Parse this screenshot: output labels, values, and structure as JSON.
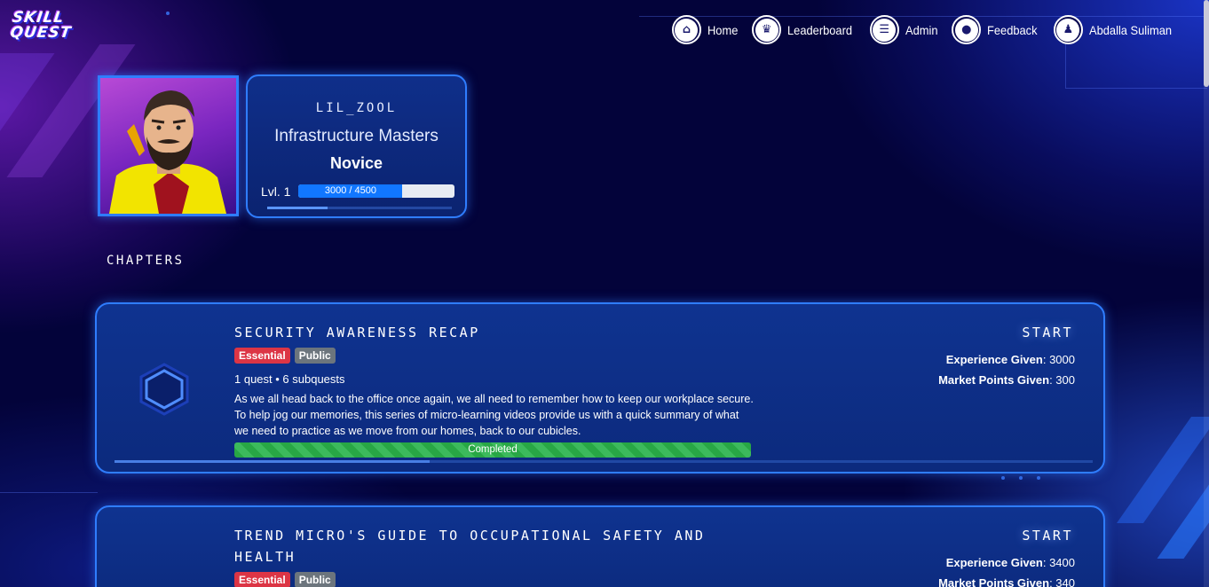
{
  "brand": {
    "line1": "SKILL",
    "line2": "QUEST"
  },
  "nav": [
    {
      "label": "Home",
      "icon": "home-icon",
      "glyph": "⌂"
    },
    {
      "label": "Leaderboard",
      "icon": "trophy-icon",
      "glyph": "♛"
    },
    {
      "label": "Admin",
      "icon": "list-icon",
      "glyph": "☰"
    },
    {
      "label": "Feedback",
      "icon": "chat-bubble-icon",
      "glyph": "●"
    },
    {
      "label": "Abdalla Suliman",
      "icon": "user-icon",
      "glyph": "♟"
    }
  ],
  "profile": {
    "username": "lil_zool",
    "team": "Infrastructure Masters",
    "rank": "Novice",
    "level": "Lvl. 1",
    "xp_text": "3000 / 4500",
    "xp_fraction": 0.667
  },
  "section_title": "CHAPTERS",
  "chapters": [
    {
      "title": "Security Awareness Recap",
      "tags": [
        "Essential",
        "Public"
      ],
      "meta": "1 quest • 6 subquests",
      "description": "As we all head back to the office once again, we all need to remember how to keep our workplace secure. To help jog our memories, this series of micro-learning videos provide us with a quick summary of what we need to practice as we move from our homes, back to our cubicles.",
      "progress_label": "Completed",
      "progress": 1.0,
      "action": "START",
      "experience_label": "Experience Given",
      "experience": "3000",
      "market_label": "Market Points Given",
      "market": "300"
    },
    {
      "title": "Trend Micro's Guide to Occupational Safety and Health",
      "tags": [
        "Essential",
        "Public"
      ],
      "action": "START",
      "experience_label": "Experience Given",
      "experience": "3400",
      "market_label": "Market Points Given",
      "market": "340"
    }
  ],
  "colors": {
    "accent": "#2f7dff",
    "card_bg": "#0f3390",
    "essential_tag": "#dc3545",
    "public_tag": "#6c757d",
    "progress_complete": "#28a745",
    "xp_fill": "#1177ff"
  }
}
